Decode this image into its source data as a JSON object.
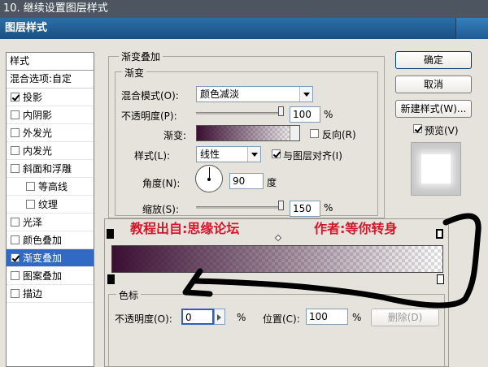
{
  "window": {
    "caption": "10. 继续设置图层样式",
    "title": "图层样式"
  },
  "style_list": {
    "header": "样式",
    "blend_options": "混合选项:自定",
    "items": [
      {
        "label": "投影",
        "checked": true
      },
      {
        "label": "内阴影",
        "checked": false
      },
      {
        "label": "外发光",
        "checked": false
      },
      {
        "label": "内发光",
        "checked": false
      },
      {
        "label": "斜面和浮雕",
        "checked": false
      },
      {
        "label": "等高线",
        "checked": false
      },
      {
        "label": "纹理",
        "checked": false
      },
      {
        "label": "光泽",
        "checked": false
      },
      {
        "label": "颜色叠加",
        "checked": false
      },
      {
        "label": "渐变叠加",
        "checked": true
      },
      {
        "label": "图案叠加",
        "checked": false
      },
      {
        "label": "描边",
        "checked": false
      }
    ]
  },
  "gradient_overlay": {
    "section_title": "渐变叠加",
    "group_title": "渐变",
    "blend_mode_label": "混合模式(O):",
    "blend_mode_value": "颜色减淡",
    "opacity_label": "不透明度(P):",
    "opacity_value": "100",
    "opacity_unit": "%",
    "opacity_level": 1.0,
    "gradient_label": "渐变:",
    "reverse_label": "反向(R)",
    "style_label": "样式(L):",
    "style_value": "线性",
    "align_label": "与图层对齐(I)",
    "angle_label": "角度(N):",
    "angle_value": "90",
    "angle_unit": "度",
    "scale_label": "缩放(S):",
    "scale_value": "150",
    "scale_unit": "%",
    "scale_level": 1.0
  },
  "buttons": {
    "ok": "确定",
    "cancel": "取消",
    "new_style": "新建样式(W)...",
    "preview": "预览(V)"
  },
  "color_stops": {
    "title": "色标",
    "opacity_label": "不透明度(O):",
    "opacity_value": "0",
    "opacity_unit": "%",
    "location_label": "位置(C):",
    "location_value": "100",
    "location_unit": "%",
    "delete_label": "删除(D)"
  },
  "annotations": {
    "source": "教程出自:思缘论坛",
    "author": "作者:等你转身"
  },
  "colors": {
    "gradient_start": "#3a0f32",
    "annotation": "#d6162a",
    "selection": "#316ac5"
  }
}
